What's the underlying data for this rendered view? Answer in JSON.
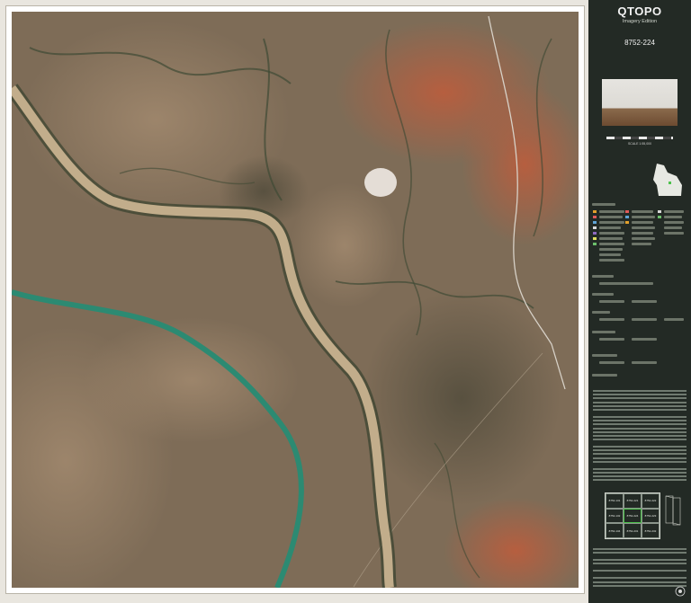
{
  "panel": {
    "title": "QTOPO",
    "subtitle": "Imagery Edition",
    "sheet_number": "8752-224",
    "scale": "SCALE 1:55,000"
  },
  "index_grid": {
    "cells": [
      "8752-131",
      "8752-221",
      "8752-222",
      "8752-132",
      "8752-224",
      "8752-223",
      "8752-134",
      "8752-231",
      "8752-232"
    ],
    "current": "8752-224"
  },
  "colors": {
    "river_main": "#c2ad8b",
    "river_green": "#2c8a72",
    "terrain": "#7b6a55",
    "red_soil": "#b85a3a",
    "panel_bg": "#232a25",
    "index_highlight": "#4cc24c"
  },
  "icons": [
    "queensland-map-icon",
    "folding-diagram-icon",
    "crest-logo-icon"
  ]
}
